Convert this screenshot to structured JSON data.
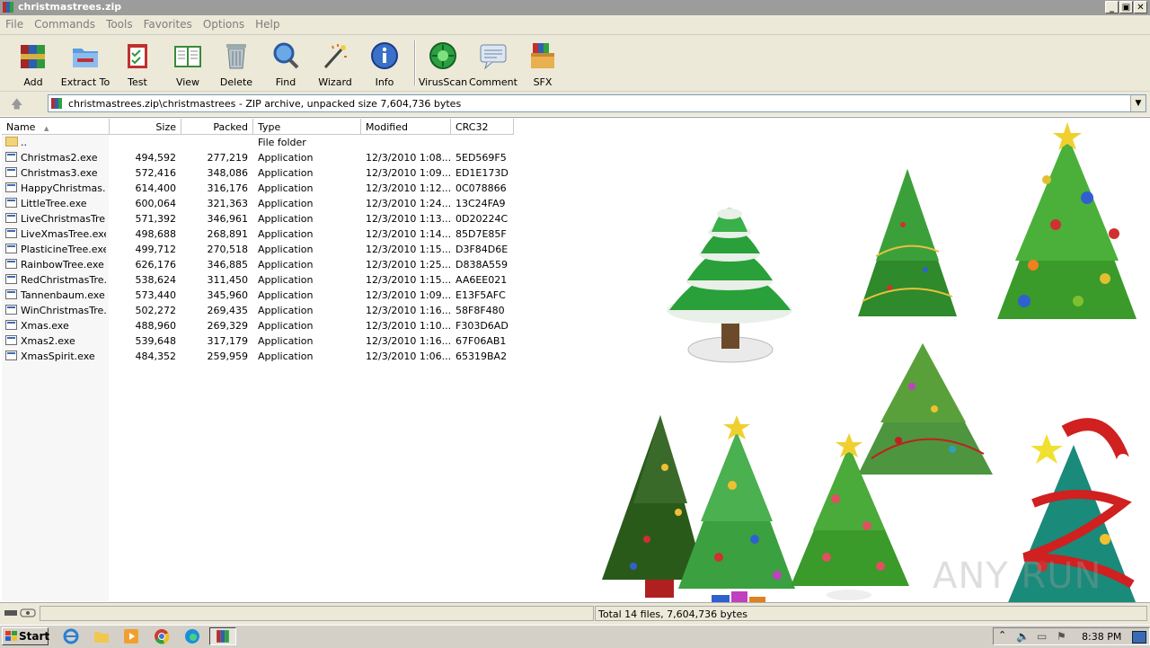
{
  "window": {
    "title": "christmastrees.zip",
    "min": "_",
    "max": "▣",
    "close": "✕"
  },
  "menu": [
    "File",
    "Commands",
    "Tools",
    "Favorites",
    "Options",
    "Help"
  ],
  "toolbar": [
    {
      "label": "Add",
      "icon": "add-books-icon"
    },
    {
      "label": "Extract To",
      "icon": "extract-folder-icon"
    },
    {
      "label": "Test",
      "icon": "test-clipboard-icon"
    },
    {
      "label": "View",
      "icon": "view-book-icon"
    },
    {
      "label": "Delete",
      "icon": "trash-icon"
    },
    {
      "label": "Find",
      "icon": "magnifier-icon"
    },
    {
      "label": "Wizard",
      "icon": "wand-icon"
    },
    {
      "label": "Info",
      "icon": "info-icon"
    },
    {
      "label": "VirusScan",
      "icon": "virus-scan-icon"
    },
    {
      "label": "Comment",
      "icon": "comment-icon"
    },
    {
      "label": "SFX",
      "icon": "sfx-box-icon"
    }
  ],
  "address": {
    "up": "🡅",
    "path": "christmastrees.zip\\christmastrees - ZIP archive, unpacked size 7,604,736 bytes"
  },
  "columns": {
    "name": "Name",
    "sort": "▲",
    "size": "Size",
    "packed": "Packed",
    "type": "Type",
    "modified": "Modified",
    "crc": "CRC32"
  },
  "parent": {
    "name": "..",
    "type": "File folder"
  },
  "files": [
    {
      "name": "Christmas2.exe",
      "size": "494,592",
      "packed": "277,219",
      "type": "Application",
      "modified": "12/3/2010 1:08...",
      "crc": "5ED569F5"
    },
    {
      "name": "Christmas3.exe",
      "size": "572,416",
      "packed": "348,086",
      "type": "Application",
      "modified": "12/3/2010 1:09...",
      "crc": "ED1E173D"
    },
    {
      "name": "HappyChristmas....",
      "size": "614,400",
      "packed": "316,176",
      "type": "Application",
      "modified": "12/3/2010 1:12...",
      "crc": "0C078866"
    },
    {
      "name": "LittleTree.exe",
      "size": "600,064",
      "packed": "321,363",
      "type": "Application",
      "modified": "12/3/2010 1:24...",
      "crc": "13C24FA9"
    },
    {
      "name": "LiveChristmasTre...",
      "size": "571,392",
      "packed": "346,961",
      "type": "Application",
      "modified": "12/3/2010 1:13...",
      "crc": "0D20224C"
    },
    {
      "name": "LiveXmasTree.exe",
      "size": "498,688",
      "packed": "268,891",
      "type": "Application",
      "modified": "12/3/2010 1:14...",
      "crc": "85D7E85F"
    },
    {
      "name": "PlasticineTree.exe",
      "size": "499,712",
      "packed": "270,518",
      "type": "Application",
      "modified": "12/3/2010 1:15...",
      "crc": "D3F84D6E"
    },
    {
      "name": "RainbowTree.exe",
      "size": "626,176",
      "packed": "346,885",
      "type": "Application",
      "modified": "12/3/2010 1:25...",
      "crc": "D838A559"
    },
    {
      "name": "RedChristmasTre...",
      "size": "538,624",
      "packed": "311,450",
      "type": "Application",
      "modified": "12/3/2010 1:15...",
      "crc": "AA6EE021"
    },
    {
      "name": "Tannenbaum.exe",
      "size": "573,440",
      "packed": "345,960",
      "type": "Application",
      "modified": "12/3/2010 1:09...",
      "crc": "E13F5AFC"
    },
    {
      "name": "WinChristmasTre...",
      "size": "502,272",
      "packed": "269,435",
      "type": "Application",
      "modified": "12/3/2010 1:16...",
      "crc": "58F8F480"
    },
    {
      "name": "Xmas.exe",
      "size": "488,960",
      "packed": "269,329",
      "type": "Application",
      "modified": "12/3/2010 1:10...",
      "crc": "F303D6AD"
    },
    {
      "name": "Xmas2.exe",
      "size": "539,648",
      "packed": "317,179",
      "type": "Application",
      "modified": "12/3/2010 1:16...",
      "crc": "67F06AB1"
    },
    {
      "name": "XmasSpirit.exe",
      "size": "484,352",
      "packed": "259,959",
      "type": "Application",
      "modified": "12/3/2010 1:06...",
      "crc": "65319BA2"
    }
  ],
  "status": {
    "summary": "Total 14 files, 7,604,736 bytes"
  },
  "taskbar": {
    "start": "Start",
    "clock": "8:38 PM"
  },
  "watermark": "ANY RUN",
  "colors": {
    "titlebar": "#9c9c9c",
    "chrome": "#ece9d8",
    "taskbar": "#d4d0c8"
  }
}
